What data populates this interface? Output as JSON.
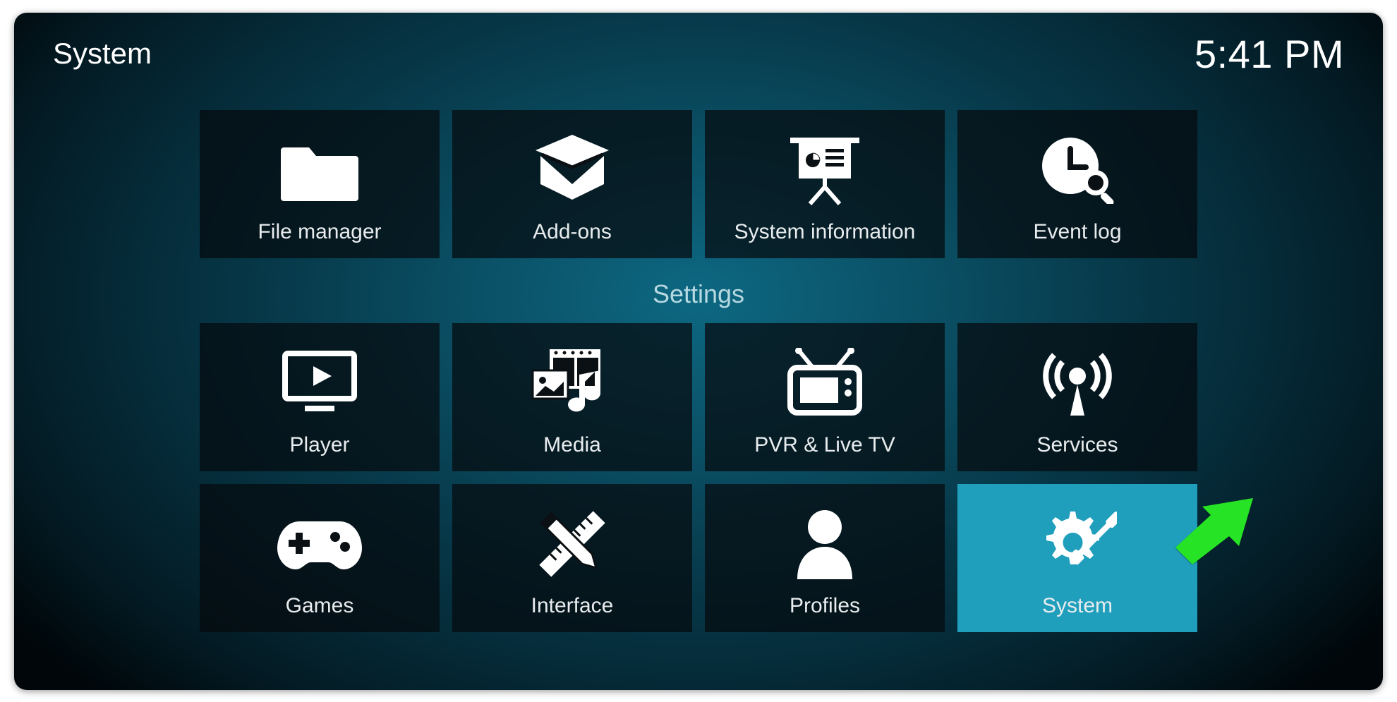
{
  "header": {
    "title": "System",
    "clock": "5:41 PM"
  },
  "section_label": "Settings",
  "tiles_top": [
    {
      "id": "file-manager",
      "label": "File manager",
      "icon": "folder-icon"
    },
    {
      "id": "addons",
      "label": "Add-ons",
      "icon": "box-icon"
    },
    {
      "id": "sysinfo",
      "label": "System information",
      "icon": "presentation-icon"
    },
    {
      "id": "eventlog",
      "label": "Event log",
      "icon": "clock-search-icon"
    }
  ],
  "tiles_mid": [
    {
      "id": "player",
      "label": "Player",
      "icon": "play-icon"
    },
    {
      "id": "media",
      "label": "Media",
      "icon": "media-icon"
    },
    {
      "id": "pvr",
      "label": "PVR & Live TV",
      "icon": "tv-icon"
    },
    {
      "id": "services",
      "label": "Services",
      "icon": "broadcast-icon"
    }
  ],
  "tiles_bot": [
    {
      "id": "games",
      "label": "Games",
      "icon": "gamepad-icon"
    },
    {
      "id": "interface",
      "label": "Interface",
      "icon": "rulers-icon"
    },
    {
      "id": "profiles",
      "label": "Profiles",
      "icon": "person-icon"
    },
    {
      "id": "system",
      "label": "System",
      "icon": "gear-tool-icon",
      "selected": true
    }
  ],
  "colors": {
    "highlight": "#209fbd",
    "arrow": "#26e326"
  }
}
